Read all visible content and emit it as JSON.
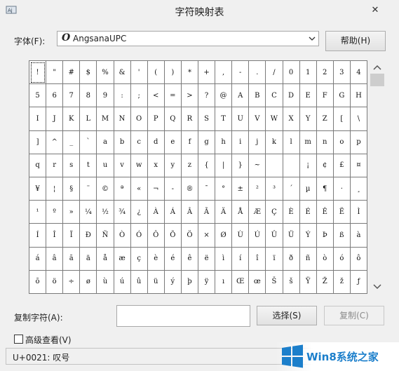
{
  "window": {
    "title": "字符映射表",
    "close_label": "✕"
  },
  "font": {
    "label": "字体(F):",
    "selected": "AngsanaUPC",
    "icon_glyph": "O"
  },
  "help_button": "帮助(H)",
  "characters": [
    "!",
    "\"",
    "#",
    "$",
    "%",
    "&",
    "'",
    "(",
    ")",
    "*",
    "+",
    ",",
    "-",
    ".",
    "/",
    "0",
    "1",
    "2",
    "3",
    "4",
    "5",
    "6",
    "7",
    "8",
    "9",
    ":",
    ";",
    "<",
    "=",
    ">",
    "?",
    "@",
    "A",
    "B",
    "C",
    "D",
    "E",
    "F",
    "G",
    "H",
    "I",
    "J",
    "K",
    "L",
    "M",
    "N",
    "O",
    "P",
    "Q",
    "R",
    "S",
    "T",
    "U",
    "V",
    "W",
    "X",
    "Y",
    "Z",
    "[",
    "\\",
    "]",
    "^",
    "_",
    "`",
    "a",
    "b",
    "c",
    "d",
    "e",
    "f",
    "g",
    "h",
    "i",
    "j",
    "k",
    "l",
    "m",
    "n",
    "o",
    "p",
    "q",
    "r",
    "s",
    "t",
    "u",
    "v",
    "w",
    "x",
    "y",
    "z",
    "{",
    "|",
    "}",
    "~",
    "",
    "",
    "¡",
    "¢",
    "£",
    "¤",
    "¥",
    "¦",
    "§",
    "¨",
    "©",
    "ª",
    "«",
    "¬",
    "-",
    "®",
    "¯",
    "°",
    "±",
    "²",
    "³",
    "´",
    "µ",
    "¶",
    "·",
    "¸",
    "¹",
    "º",
    "»",
    "¼",
    "½",
    "¾",
    "¿",
    "À",
    "Á",
    "Â",
    "Ã",
    "Ä",
    "Å",
    "Æ",
    "Ç",
    "È",
    "É",
    "Ê",
    "Ë",
    "Ì",
    "Í",
    "Î",
    "Ï",
    "Ð",
    "Ñ",
    "Ò",
    "Ó",
    "Ô",
    "Õ",
    "Ö",
    "×",
    "Ø",
    "Ù",
    "Ú",
    "Û",
    "Ü",
    "Ý",
    "Þ",
    "ß",
    "à",
    "á",
    "â",
    "ã",
    "ä",
    "å",
    "æ",
    "ç",
    "è",
    "é",
    "ê",
    "ë",
    "ì",
    "í",
    "î",
    "ï",
    "ð",
    "ñ",
    "ò",
    "ó",
    "ô",
    "õ",
    "ö",
    "÷",
    "ø",
    "ù",
    "ú",
    "û",
    "ü",
    "ý",
    "þ",
    "ÿ",
    "ı",
    "Œ",
    "œ",
    "Š",
    "š",
    "Ÿ",
    "Ž",
    "ž",
    "ƒ"
  ],
  "copy": {
    "label": "复制字符(A):",
    "value": "",
    "select_button": "选择(S)",
    "copy_button": "复制(C)"
  },
  "advanced": {
    "label": "高级查看(V)",
    "checked": false
  },
  "status": "U+0021: 叹号",
  "watermark": {
    "text": "Win8系统之家"
  }
}
